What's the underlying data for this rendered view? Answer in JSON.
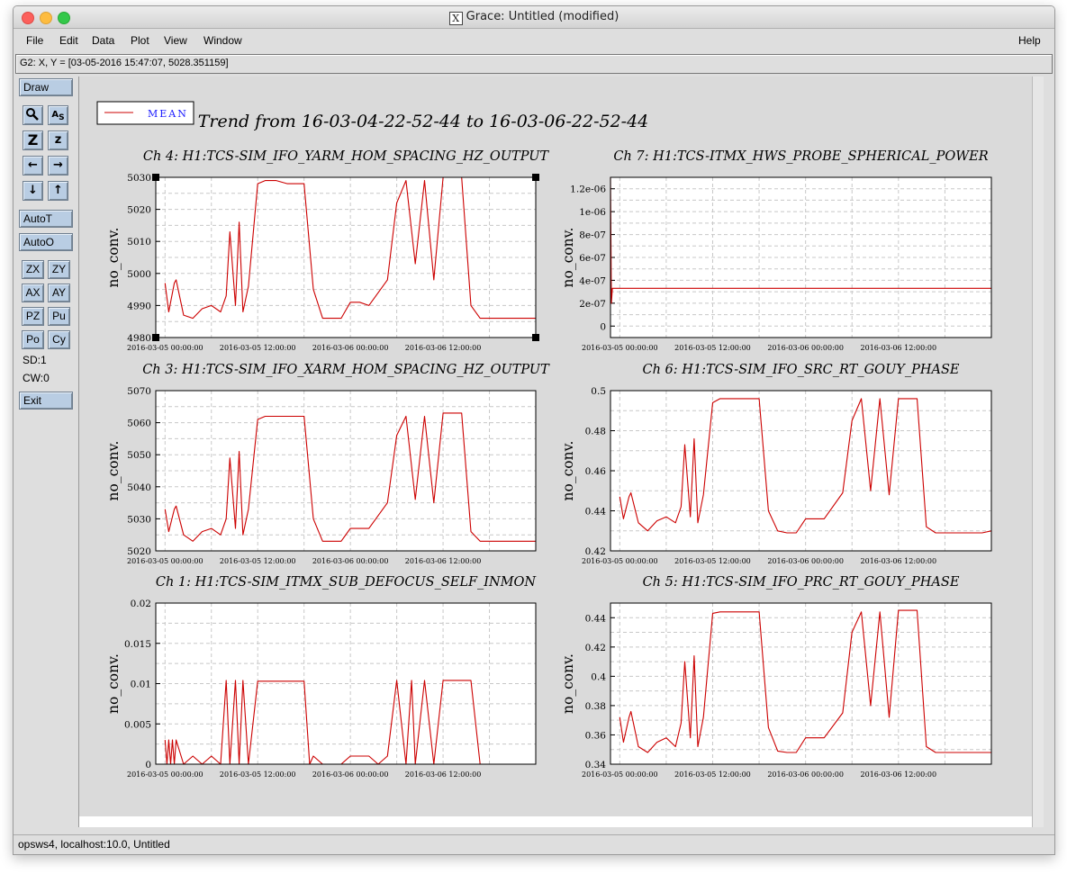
{
  "window": {
    "title": "Grace: Untitled (modified)",
    "x_glyph": "X"
  },
  "menubar": {
    "file": "File",
    "edit": "Edit",
    "data": "Data",
    "plot": "Plot",
    "view": "View",
    "window": "Window",
    "help": "Help"
  },
  "locator": {
    "text": "G2: X, Y = [03-05-2016 15:47:07, 5028.351159]"
  },
  "toolbar": {
    "draw": "Draw",
    "autot": "AutoT",
    "autoo": "AutoO",
    "zx": "ZX",
    "zy": "ZY",
    "ax": "AX",
    "ay": "AY",
    "pz": "PZ",
    "pu": "Pu",
    "po": "Po",
    "cy": "Cy",
    "sd": "SD:1",
    "cw": "CW:0",
    "exit": "Exit",
    "icons": {
      "zoom": "magnifier-icon",
      "text": "text-icon",
      "zoom_in": "Z",
      "zoom_out": "z",
      "left": "←",
      "right": "→",
      "down": "↓",
      "up": "↑"
    }
  },
  "status": {
    "text": "opsws4, localhost:10.0, Untitled"
  },
  "legend": {
    "label": "MEAN",
    "color": "#1a1aff",
    "line_color": "#cc0000"
  },
  "plot_title": "Trend from 16-03-04-22-52-44 to 16-03-06-22-52-44",
  "colors": {
    "series": "#cc0000",
    "grid": "#c8c8c8",
    "page": "#dadada"
  },
  "chart_data": [
    {
      "type": "line",
      "title": "Ch 4: H1:TCS-SIM_IFO_YARM_HOM_SPACING_HZ_OUTPUT",
      "ylabel": "no_conv.",
      "ylim": [
        4980,
        5030
      ],
      "yticks": [
        "4980",
        "4990",
        "5000",
        "5010",
        "5020",
        "5030"
      ],
      "xticks": [
        "2016-03-05 00:00:00",
        "2016-03-05 12:00:00",
        "2016-03-06 00:00:00",
        "2016-03-06 12:00:00"
      ],
      "selected": true,
      "series": [
        {
          "name": "MEAN",
          "x": [
            0,
            0.02,
            0.05,
            0.06,
            0.1,
            0.15,
            0.2,
            0.25,
            0.3,
            0.33,
            0.35,
            0.38,
            0.4,
            0.42,
            0.45,
            0.5,
            0.54,
            0.56,
            0.58,
            0.6,
            0.66,
            0.75,
            0.8,
            0.85,
            0.9,
            0.95,
            1.0,
            1.05,
            1.1,
            1.2,
            1.25,
            1.3,
            1.35,
            1.4,
            1.45,
            1.5,
            1.55,
            1.6,
            1.65,
            1.7,
            1.75,
            1.8,
            1.85,
            1.9,
            1.95,
            2.0
          ],
          "y": [
            4997,
            4988,
            4997,
            4998,
            4987,
            4986,
            4989,
            4990,
            4988,
            4993,
            5013,
            4990,
            5016,
            4988,
            4996,
            5028,
            5029,
            5029,
            5029,
            5029,
            5028,
            5028,
            4995,
            4986,
            4986,
            4986,
            4991,
            4991,
            4990,
            4998,
            5022,
            5029,
            5003,
            5029,
            4998,
            5030,
            5030,
            5030,
            4990,
            4986,
            4986,
            4986,
            4986,
            4986,
            4986,
            4986
          ]
        }
      ]
    },
    {
      "type": "line",
      "title": "Ch 7: H1:TCS-ITMX_HWS_PROBE_SPHERICAL_POWER",
      "ylabel": "no_conv.",
      "ylim": [
        -1e-07,
        1.3e-06
      ],
      "yticks": [
        "0",
        "2e-07",
        "4e-07",
        "6e-07",
        "8e-07",
        "1e-06",
        "1.2e-06"
      ],
      "xticks": [
        "2016-03-05 00:00:00",
        "2016-03-05 12:00:00",
        "2016-03-06 00:00:00",
        "2016-03-06 12:00:00"
      ],
      "series": [
        {
          "name": "MEAN",
          "x": [
            -0.05,
            -0.045,
            -0.04,
            2.0
          ],
          "y": [
            1.3e-06,
            2e-07,
            3.3e-07,
            3.3e-07
          ]
        }
      ]
    },
    {
      "type": "line",
      "title": "Ch 3: H1:TCS-SIM_IFO_XARM_HOM_SPACING_HZ_OUTPUT",
      "ylabel": "no_conv.",
      "ylim": [
        5020,
        5070
      ],
      "yticks": [
        "5020",
        "5030",
        "5040",
        "5050",
        "5060",
        "5070"
      ],
      "xticks": [
        "2016-03-05 00:00:00",
        "2016-03-05 12:00:00",
        "2016-03-06 00:00:00",
        "2016-03-06 12:00:00"
      ],
      "series": [
        {
          "name": "MEAN",
          "x": [
            0,
            0.02,
            0.05,
            0.06,
            0.1,
            0.15,
            0.2,
            0.25,
            0.3,
            0.33,
            0.35,
            0.38,
            0.4,
            0.42,
            0.45,
            0.5,
            0.54,
            0.56,
            0.58,
            0.6,
            0.66,
            0.75,
            0.8,
            0.85,
            0.9,
            0.95,
            1.0,
            1.05,
            1.1,
            1.2,
            1.25,
            1.3,
            1.35,
            1.4,
            1.45,
            1.5,
            1.55,
            1.6,
            1.65,
            1.7,
            1.75,
            1.8,
            1.85,
            1.9,
            1.95,
            2.0
          ],
          "y": [
            5033,
            5026,
            5033,
            5034,
            5025,
            5023,
            5026,
            5027,
            5025,
            5030,
            5049,
            5027,
            5051,
            5025,
            5033,
            5061,
            5062,
            5062,
            5062,
            5062,
            5062,
            5062,
            5030,
            5023,
            5023,
            5023,
            5027,
            5027,
            5027,
            5035,
            5056,
            5062,
            5036,
            5062,
            5035,
            5063,
            5063,
            5063,
            5026,
            5023,
            5023,
            5023,
            5023,
            5023,
            5023,
            5023
          ]
        }
      ]
    },
    {
      "type": "line",
      "title": "Ch 6: H1:TCS-SIM_IFO_SRC_RT_GOUY_PHASE",
      "ylabel": "no_conv.",
      "ylim": [
        0.42,
        0.5
      ],
      "yticks": [
        "0.42",
        "0.44",
        "0.46",
        "0.48",
        "0.5"
      ],
      "xticks": [
        "2016-03-05 00:00:00",
        "2016-03-05 12:00:00",
        "2016-03-06 00:00:00",
        "2016-03-06 12:00:00"
      ],
      "series": [
        {
          "name": "MEAN",
          "x": [
            0,
            0.02,
            0.05,
            0.06,
            0.1,
            0.15,
            0.2,
            0.25,
            0.3,
            0.33,
            0.35,
            0.38,
            0.4,
            0.42,
            0.45,
            0.5,
            0.54,
            0.56,
            0.58,
            0.6,
            0.66,
            0.75,
            0.8,
            0.85,
            0.9,
            0.95,
            1.0,
            1.05,
            1.1,
            1.2,
            1.25,
            1.3,
            1.35,
            1.4,
            1.45,
            1.5,
            1.55,
            1.6,
            1.65,
            1.7,
            1.75,
            1.8,
            1.85,
            1.9,
            1.95,
            2.0
          ],
          "y": [
            0.447,
            0.436,
            0.447,
            0.449,
            0.434,
            0.43,
            0.435,
            0.437,
            0.434,
            0.442,
            0.473,
            0.437,
            0.476,
            0.434,
            0.448,
            0.494,
            0.496,
            0.496,
            0.496,
            0.496,
            0.496,
            0.496,
            0.44,
            0.43,
            0.429,
            0.429,
            0.436,
            0.436,
            0.436,
            0.449,
            0.485,
            0.496,
            0.45,
            0.496,
            0.448,
            0.496,
            0.496,
            0.496,
            0.432,
            0.429,
            0.429,
            0.429,
            0.429,
            0.429,
            0.429,
            0.43
          ]
        }
      ]
    },
    {
      "type": "line",
      "title": "Ch 1: H1:TCS-SIM_ITMX_SUB_DEFOCUS_SELF_INMON",
      "ylabel": "no_conv.",
      "ylim": [
        0,
        0.02
      ],
      "yticks": [
        "0",
        "0.005",
        "0.01",
        "0.015",
        "0.02"
      ],
      "xticks": [
        "2016-03-05 00:00:00",
        "2016-03-05 12:00:00",
        "2016-03-06 00:00:00",
        "2016-03-06 12:00:00"
      ],
      "series": [
        {
          "name": "MEAN",
          "x": [
            0,
            0.01,
            0.02,
            0.03,
            0.04,
            0.05,
            0.06,
            0.1,
            0.15,
            0.2,
            0.25,
            0.3,
            0.33,
            0.35,
            0.38,
            0.4,
            0.42,
            0.45,
            0.5,
            0.55,
            0.6,
            0.7,
            0.75,
            0.78,
            0.8,
            0.85,
            0.9,
            0.95,
            1.0,
            1.05,
            1.1,
            1.15,
            1.2,
            1.25,
            1.3,
            1.33,
            1.35,
            1.4,
            1.45,
            1.5,
            1.55,
            1.6,
            1.65,
            1.7,
            1.75,
            1.8
          ],
          "y": [
            0.003,
            0,
            0.003,
            0,
            0.003,
            0,
            0.003,
            0,
            0.001,
            0,
            0.001,
            0,
            0.0104,
            0,
            0.0104,
            0,
            0.0104,
            0,
            0.0103,
            0.0103,
            0.0103,
            0.0103,
            0.0103,
            0,
            0.001,
            0,
            0,
            0,
            0.001,
            0.001,
            0.001,
            0,
            0.001,
            0.0104,
            0,
            0.0104,
            0,
            0.0104,
            0,
            0.0104,
            0.0104,
            0.0104,
            0.0104,
            0,
            0,
            0
          ]
        }
      ]
    },
    {
      "type": "line",
      "title": "Ch 5: H1:TCS-SIM_IFO_PRC_RT_GOUY_PHASE",
      "ylabel": "no_conv.",
      "ylim": [
        0.34,
        0.45
      ],
      "yticks": [
        "0.34",
        "0.36",
        "0.38",
        "0.4",
        "0.42",
        "0.44"
      ],
      "xticks": [
        "2016-03-05 00:00:00",
        "2016-03-05 12:00:00",
        "2016-03-06 00:00:00",
        "2016-03-06 12:00:00"
      ],
      "series": [
        {
          "name": "MEAN",
          "x": [
            0,
            0.02,
            0.05,
            0.06,
            0.1,
            0.15,
            0.2,
            0.25,
            0.3,
            0.33,
            0.35,
            0.38,
            0.4,
            0.42,
            0.45,
            0.5,
            0.54,
            0.56,
            0.58,
            0.6,
            0.66,
            0.75,
            0.8,
            0.85,
            0.9,
            0.95,
            1.0,
            1.05,
            1.1,
            1.2,
            1.25,
            1.3,
            1.35,
            1.4,
            1.45,
            1.5,
            1.55,
            1.6,
            1.65,
            1.7,
            1.75,
            1.8,
            1.85,
            1.9,
            1.95,
            2.0
          ],
          "y": [
            0.372,
            0.355,
            0.372,
            0.376,
            0.352,
            0.348,
            0.355,
            0.358,
            0.352,
            0.368,
            0.41,
            0.358,
            0.414,
            0.352,
            0.372,
            0.443,
            0.444,
            0.444,
            0.444,
            0.444,
            0.444,
            0.444,
            0.365,
            0.349,
            0.348,
            0.348,
            0.358,
            0.358,
            0.358,
            0.375,
            0.43,
            0.444,
            0.38,
            0.444,
            0.372,
            0.445,
            0.445,
            0.445,
            0.352,
            0.348,
            0.348,
            0.348,
            0.348,
            0.348,
            0.348,
            0.348
          ]
        }
      ]
    }
  ]
}
